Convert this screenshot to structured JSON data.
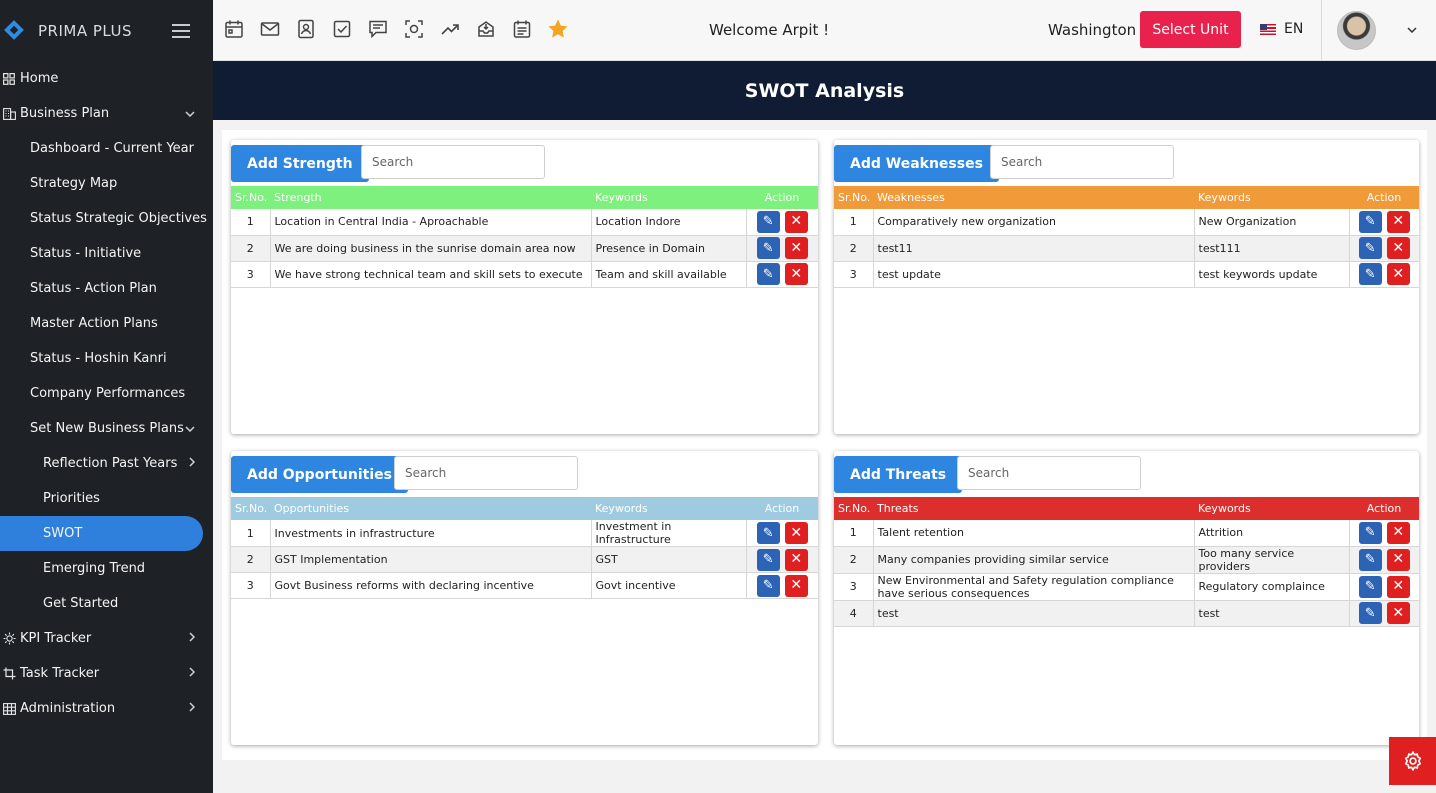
{
  "app": {
    "name": "PRIMA PLUS"
  },
  "sidebar": {
    "items": [
      {
        "label": "Home"
      },
      {
        "label": "Business Plan"
      },
      {
        "label": "Dashboard - Current Year"
      },
      {
        "label": "Strategy Map"
      },
      {
        "label": "Status Strategic Objectives"
      },
      {
        "label": "Status - Initiative"
      },
      {
        "label": "Status - Action Plan"
      },
      {
        "label": "Master Action Plans"
      },
      {
        "label": "Status - Hoshin Kanri"
      },
      {
        "label": "Company Performances"
      },
      {
        "label": "Set New Business Plans"
      },
      {
        "label": "Reflection Past Years"
      },
      {
        "label": "Priorities"
      },
      {
        "label": "SWOT"
      },
      {
        "label": "Emerging Trend"
      },
      {
        "label": "Get Started"
      },
      {
        "label": "KPI Tracker"
      },
      {
        "label": "Task Tracker"
      },
      {
        "label": "Administration"
      }
    ]
  },
  "topbar": {
    "welcome": "Welcome  Arpit !",
    "city": "Washington",
    "select_unit": "Select Unit",
    "language": "EN"
  },
  "page": {
    "title": "SWOT Analysis"
  },
  "colors": {
    "strength": "#7ef07e",
    "weakness": "#f09a3a",
    "opportunity": "#9ecbe0",
    "threat": "#dd2e2e",
    "accent": "#2f86e0"
  },
  "strength": {
    "add_label": "Add Strength",
    "search_placeholder": "Search",
    "headers": [
      "Sr.No.",
      "Strength",
      "Keywords",
      "Action"
    ],
    "rows": [
      [
        "1",
        "Location in Central India - Aproachable",
        "Location Indore"
      ],
      [
        "2",
        "We are doing business in the sunrise domain area now",
        "Presence in Domain"
      ],
      [
        "3",
        "We have strong technical team and skill sets to execute",
        "Team and skill available"
      ]
    ]
  },
  "weakness": {
    "add_label": "Add Weaknesses",
    "search_placeholder": "Search",
    "headers": [
      "Sr.No.",
      "Weaknesses",
      "Keywords",
      "Action"
    ],
    "rows": [
      [
        "1",
        "Comparatively new organization",
        "New Organization"
      ],
      [
        "2",
        "test11",
        "test111"
      ],
      [
        "3",
        "test update",
        "test keywords update"
      ]
    ]
  },
  "opportunity": {
    "add_label": "Add Opportunities",
    "search_placeholder": "Search",
    "headers": [
      "Sr.No.",
      "Opportunities",
      "Keywords",
      "Action"
    ],
    "rows": [
      [
        "1",
        "Investments in infrastructure",
        "Investment in Infrastructure"
      ],
      [
        "2",
        "GST Implementation",
        "GST"
      ],
      [
        "3",
        "Govt Business reforms with declaring incentive",
        "Govt incentive"
      ]
    ]
  },
  "threat": {
    "add_label": "Add Threats",
    "search_placeholder": "Search",
    "headers": [
      "Sr.No.",
      "Threats",
      "Keywords",
      "Action"
    ],
    "rows": [
      [
        "1",
        "Talent retention",
        "Attrition"
      ],
      [
        "2",
        "Many companies providing similar service",
        "Too many service providers"
      ],
      [
        "3",
        "New Environmental and Safety regulation compliance have serious consequences",
        "Regulatory complaince"
      ],
      [
        "4",
        "test",
        "test"
      ]
    ]
  }
}
